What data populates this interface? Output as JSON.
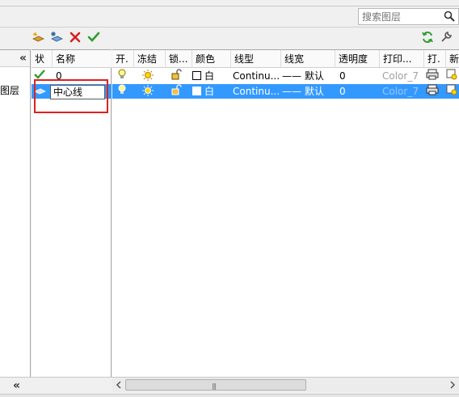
{
  "search": {
    "placeholder": "搜索图层"
  },
  "left_tree": {
    "label": "图层"
  },
  "name_columns": {
    "status": "状",
    "name": "名称"
  },
  "columns": {
    "on": "开.",
    "freeze": "冻结",
    "lock": "锁...",
    "color": "颜色",
    "linetype": "线型",
    "lineweight": "线宽",
    "transparency": "透明度",
    "plotstyle": "打印...",
    "plot": "打.",
    "newvp": "新"
  },
  "layers": [
    {
      "name": "0",
      "color": "白",
      "linetype": "Continu...",
      "lineweight_line": "——",
      "lineweight": "默认",
      "transparency": "0",
      "plotstyle": "Color_7"
    },
    {
      "name": "中心线",
      "color": "白",
      "linetype": "Continu...",
      "lineweight_line": "——",
      "lineweight": "默认",
      "transparency": "0",
      "plotstyle": "Color_7"
    }
  ],
  "scroll_grip": "|||",
  "colors": {
    "selection": "#3399ff",
    "highlight_box": "#e02020"
  }
}
